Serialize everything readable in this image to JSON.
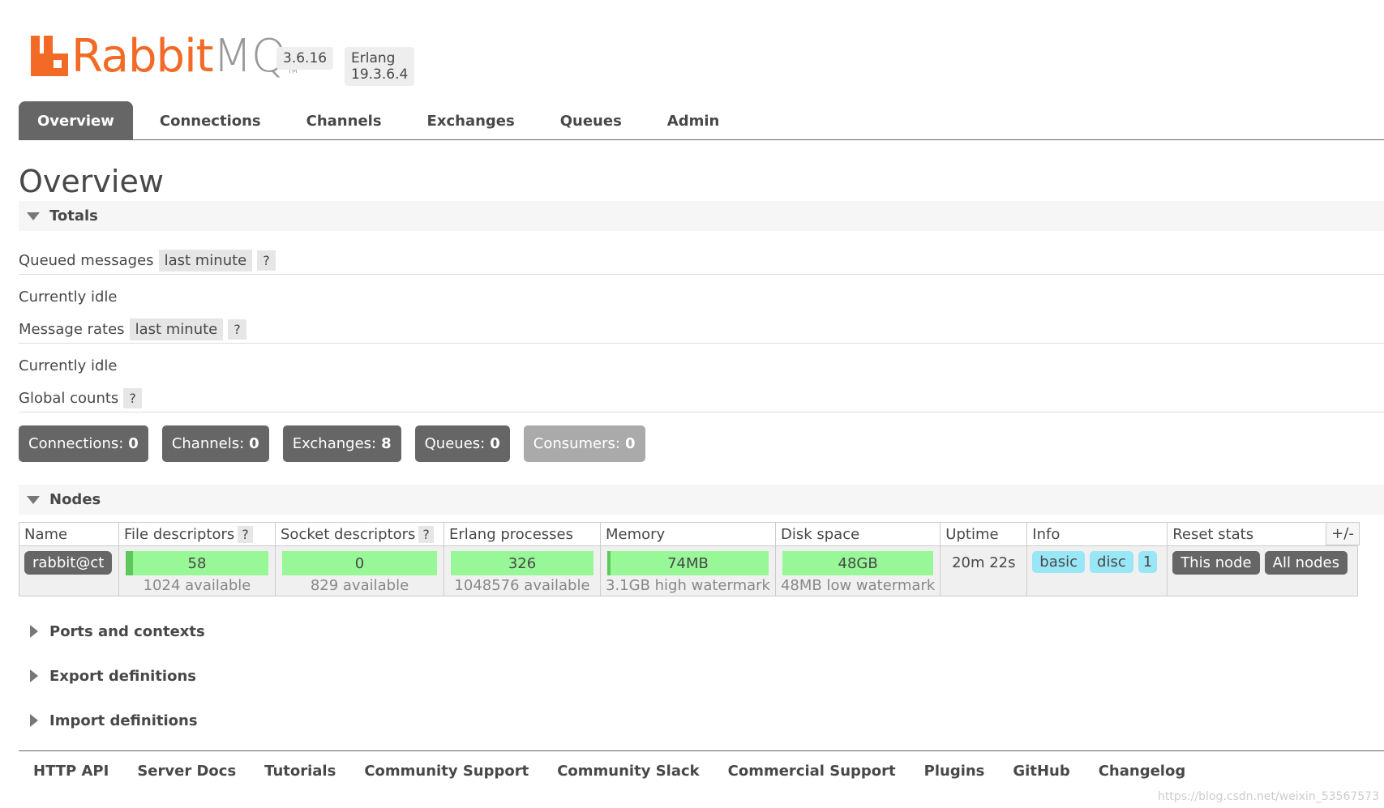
{
  "header": {
    "logo_rabbit": "Rabbit",
    "logo_mq": "MQ",
    "logo_tm": "TM",
    "version": "3.6.16",
    "erlang": "Erlang 19.3.6.4",
    "brand_color": "#f26a26"
  },
  "tabs": [
    {
      "label": "Overview",
      "active": true
    },
    {
      "label": "Connections"
    },
    {
      "label": "Channels"
    },
    {
      "label": "Exchanges"
    },
    {
      "label": "Queues"
    },
    {
      "label": "Admin"
    }
  ],
  "page_title": "Overview",
  "totals": {
    "title": "Totals",
    "queued_messages_label": "Queued messages",
    "queued_messages_range": "last minute",
    "help": "?",
    "queued_status": "Currently idle",
    "message_rates_label": "Message rates",
    "message_rates_range": "last minute",
    "rates_status": "Currently idle",
    "global_counts_label": "Global counts",
    "counts": [
      {
        "label": "Connections:",
        "value": "0"
      },
      {
        "label": "Channels:",
        "value": "0"
      },
      {
        "label": "Exchanges:",
        "value": "8"
      },
      {
        "label": "Queues:",
        "value": "0"
      },
      {
        "label": "Consumers:",
        "value": "0"
      }
    ]
  },
  "nodes": {
    "title": "Nodes",
    "headers": {
      "name": "Name",
      "file_descriptors": "File descriptors",
      "socket_descriptors": "Socket descriptors",
      "erlang_processes": "Erlang processes",
      "memory": "Memory",
      "disk_space": "Disk space",
      "uptime": "Uptime",
      "info": "Info",
      "reset_stats": "Reset stats"
    },
    "toggle_columns": "+/-",
    "row": {
      "name": "rabbit@ct",
      "file_descriptors": "58",
      "file_descriptors_sub": "1024 available",
      "socket_descriptors": "0",
      "socket_descriptors_sub": "829 available",
      "erlang_processes": "326",
      "erlang_processes_sub": "1048576 available",
      "memory": "74MB",
      "memory_sub": "3.1GB high watermark",
      "disk_space": "48GB",
      "disk_space_sub": "48MB low watermark",
      "uptime": "20m 22s",
      "info": [
        "basic",
        "disc",
        "1"
      ],
      "reset": [
        "This node",
        "All nodes"
      ]
    }
  },
  "collapsed_sections": [
    "Ports and contexts",
    "Export definitions",
    "Import definitions"
  ],
  "footer_links": [
    "HTTP API",
    "Server Docs",
    "Tutorials",
    "Community Support",
    "Community Slack",
    "Commercial Support",
    "Plugins",
    "GitHub",
    "Changelog"
  ],
  "watermark": "https://blog.csdn.net/weixin_53567573"
}
